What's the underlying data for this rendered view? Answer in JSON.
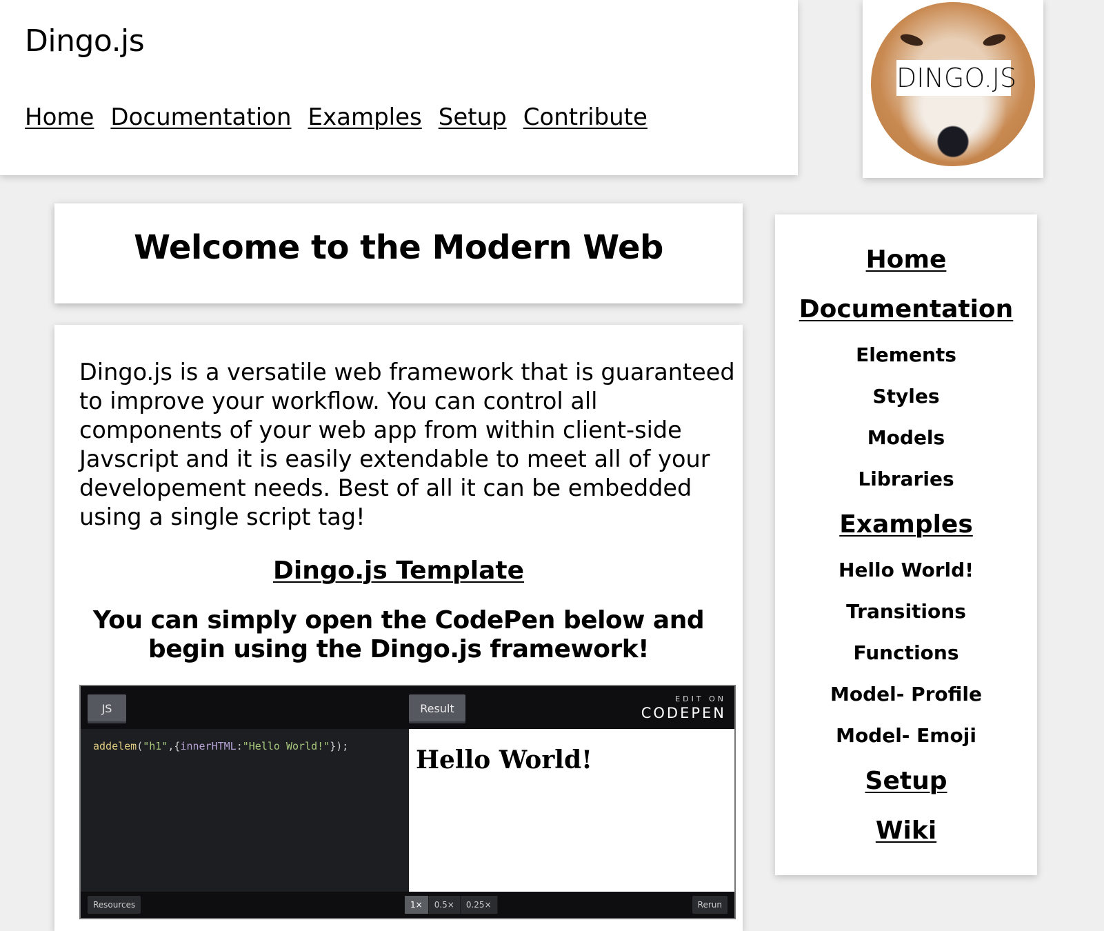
{
  "header": {
    "site_title": "Dingo.js",
    "nav": [
      "Home",
      "Documentation",
      "Examples",
      "Setup",
      "Contribute"
    ]
  },
  "logo": {
    "text": "DINGO.JS"
  },
  "welcome": {
    "title": "Welcome to the Modern Web"
  },
  "content": {
    "intro": "Dingo.js is a versatile web framework that is guaranteed to improve your workflow. You can control all components of your web app from within client-side Javscript and it is easily extendable to meet all of your developement needs. Best of all it can be embedded using a single script tag!",
    "template_link": "Dingo.js Template",
    "codepen_heading": "You can simply open the CodePen below and begin using the Dingo.js framework!"
  },
  "codepen": {
    "tab_js": "JS",
    "tab_result": "Result",
    "edit_on": "EDIT ON",
    "brand": "CODEPEN",
    "code": {
      "fn": "addelem",
      "open": "(",
      "arg1": "\"h1\"",
      "sep": ",{",
      "key": "innerHTML",
      "colon": ":",
      "arg2": "\"Hello World!\"",
      "close": "});"
    },
    "result_text": "Hello World!",
    "resources": "Resources",
    "zoom_options": [
      "1×",
      "0.5×",
      "0.25×"
    ],
    "zoom_selected": "1×",
    "rerun": "Rerun"
  },
  "sidebar": {
    "items": [
      {
        "label": "Home",
        "level": "main"
      },
      {
        "label": "Documentation",
        "level": "main"
      },
      {
        "label": "Elements",
        "level": "sub"
      },
      {
        "label": "Styles",
        "level": "sub"
      },
      {
        "label": "Models",
        "level": "sub"
      },
      {
        "label": "Libraries",
        "level": "sub"
      },
      {
        "label": "Examples",
        "level": "main"
      },
      {
        "label": "Hello World!",
        "level": "sub"
      },
      {
        "label": "Transitions",
        "level": "sub"
      },
      {
        "label": "Functions",
        "level": "sub"
      },
      {
        "label": "Model- Profile",
        "level": "sub"
      },
      {
        "label": "Model- Emoji",
        "level": "sub"
      },
      {
        "label": "Setup",
        "level": "main"
      },
      {
        "label": "Wiki",
        "level": "main"
      }
    ]
  }
}
